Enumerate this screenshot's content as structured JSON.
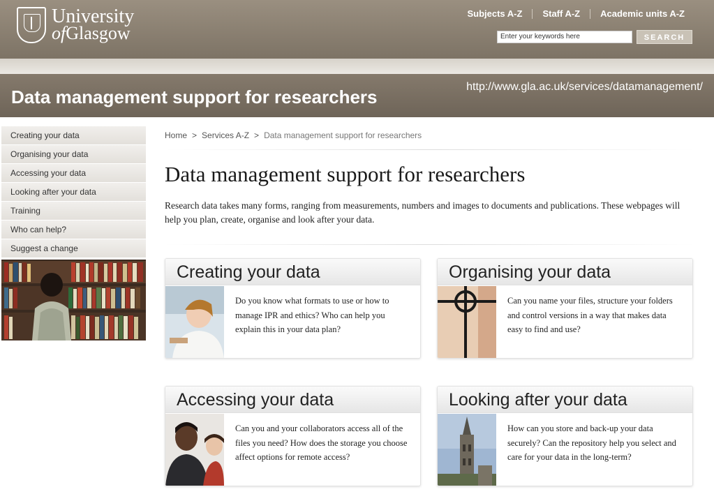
{
  "header": {
    "logo_line1": "University",
    "logo_line2_of": "of",
    "logo_line2_rest": "Glasgow",
    "nav": [
      "Subjects A-Z",
      "Staff A-Z",
      "Academic units A-Z"
    ],
    "search_placeholder": "Enter your keywords here",
    "search_button": "SEARCH"
  },
  "banner": {
    "title": "Data management support for researchers",
    "url": "http://www.gla.ac.uk/services/datamanagement/"
  },
  "sidebar": {
    "items": [
      {
        "label": "Creating your data"
      },
      {
        "label": "Organising your data"
      },
      {
        "label": "Accessing your data"
      },
      {
        "label": "Looking after your data"
      },
      {
        "label": "Training"
      },
      {
        "label": "Who can help?"
      },
      {
        "label": "Suggest a change"
      }
    ]
  },
  "breadcrumb": {
    "home": "Home",
    "sep": ">",
    "services": "Services A-Z",
    "current": "Data management support for researchers"
  },
  "main": {
    "title": "Data management support for researchers",
    "intro": "Research data takes many forms, ranging from measurements, numbers and images to documents and publications. These webpages will help you plan, create, organise and look after your data."
  },
  "cards": [
    {
      "title": "Creating your data",
      "text": "Do you know what formats to use or how to manage IPR and ethics? Who can help you explain this in your data plan?"
    },
    {
      "title": "Organising your data",
      "text": "Can you name your files, structure your folders and control versions in a way that makes data easy to find and use?"
    },
    {
      "title": "Accessing your data",
      "text": "Can you and your collaborators access all of the files you need? How does the storage you choose affect options for remote access?"
    },
    {
      "title": "Looking after your data",
      "text": "How can you store and back-up your data securely? Can the repository help you select and care for your data in the long-term?"
    }
  ]
}
